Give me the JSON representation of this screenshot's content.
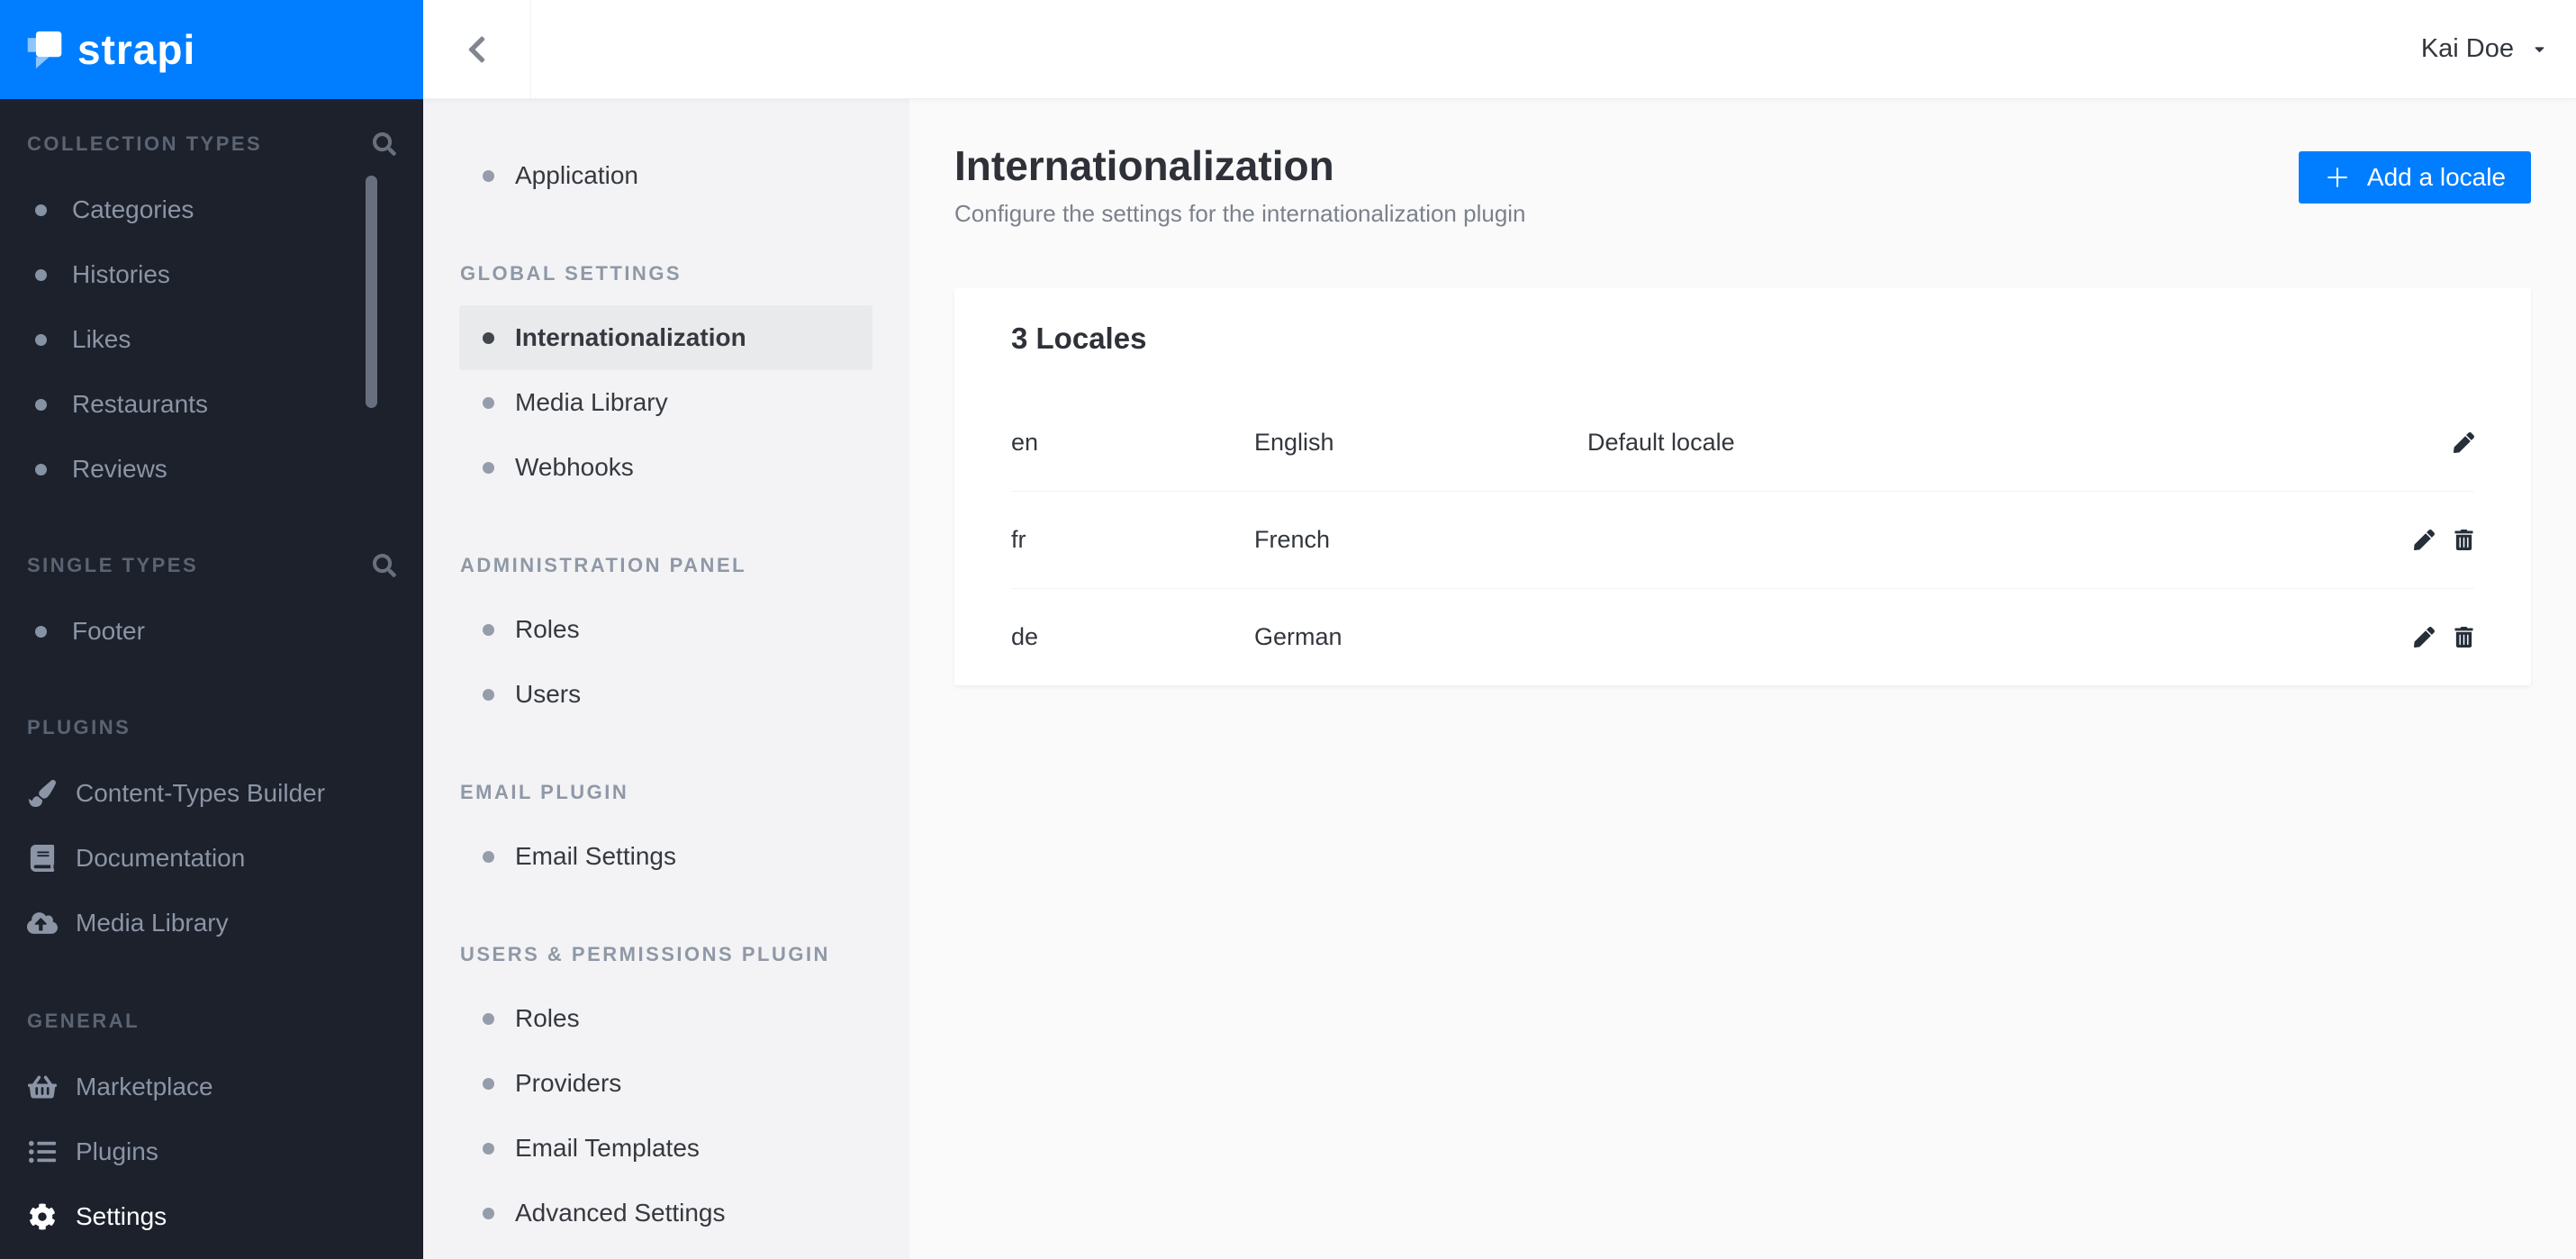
{
  "brand": {
    "name": "strapi"
  },
  "colors": {
    "accent": "#007eff",
    "sidebar_bg": "#1c212c",
    "submenu_bg": "#f3f3f5",
    "submenu_selected_bg": "#e9eaec",
    "content_bg": "#fafafb"
  },
  "left_sidebar": {
    "sections": [
      {
        "heading": "COLLECTION TYPES",
        "items": [
          {
            "label": "Categories"
          },
          {
            "label": "Histories"
          },
          {
            "label": "Likes"
          },
          {
            "label": "Restaurants"
          },
          {
            "label": "Reviews"
          }
        ]
      },
      {
        "heading": "SINGLE TYPES",
        "items": [
          {
            "label": "Footer"
          }
        ]
      },
      {
        "heading": "PLUGINS",
        "items": [
          {
            "label": "Content-Types Builder"
          },
          {
            "label": "Documentation"
          },
          {
            "label": "Media Library"
          }
        ]
      },
      {
        "heading": "GENERAL",
        "items": [
          {
            "label": "Marketplace"
          },
          {
            "label": "Plugins"
          },
          {
            "label": "Settings"
          }
        ]
      }
    ]
  },
  "settings_menu": {
    "standalone": {
      "label": "Application"
    },
    "groups": [
      {
        "heading": "GLOBAL SETTINGS",
        "items": [
          {
            "label": "Internationalization"
          },
          {
            "label": "Media Library"
          },
          {
            "label": "Webhooks"
          }
        ]
      },
      {
        "heading": "ADMINISTRATION PANEL",
        "items": [
          {
            "label": "Roles"
          },
          {
            "label": "Users"
          }
        ]
      },
      {
        "heading": "EMAIL PLUGIN",
        "items": [
          {
            "label": "Email Settings"
          }
        ]
      },
      {
        "heading": "USERS & PERMISSIONS PLUGIN",
        "items": [
          {
            "label": "Roles"
          },
          {
            "label": "Providers"
          },
          {
            "label": "Email Templates"
          },
          {
            "label": "Advanced Settings"
          }
        ]
      }
    ]
  },
  "topbar": {
    "user_name": "Kai Doe"
  },
  "page": {
    "title": "Internationalization",
    "subtitle": "Configure the settings for the internationalization plugin",
    "add_locale_button": "Add a locale"
  },
  "locales_card": {
    "heading": "3 Locales",
    "rows": [
      {
        "code": "en",
        "name": "English",
        "note": "Default locale"
      },
      {
        "code": "fr",
        "name": "French",
        "note": ""
      },
      {
        "code": "de",
        "name": "German",
        "note": ""
      }
    ]
  }
}
